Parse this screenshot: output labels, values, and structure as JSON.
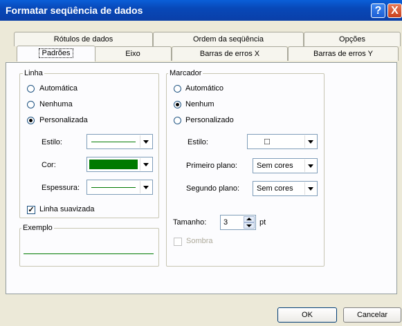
{
  "window": {
    "title": "Formatar seqüência de dados",
    "help_icon": "?",
    "close_icon": "X"
  },
  "tabs_back": [
    {
      "label": "Rótulos de dados"
    },
    {
      "label": "Ordem da seqüência"
    },
    {
      "label": "Opções"
    }
  ],
  "tabs_front": [
    {
      "label": "Padrões",
      "active": true
    },
    {
      "label": "Eixo"
    },
    {
      "label": "Barras de erros X"
    },
    {
      "label": "Barras de erros Y"
    }
  ],
  "linha": {
    "group_label": "Linha",
    "options": [
      {
        "label": "Automática",
        "selected": false
      },
      {
        "label": "Nenhuma",
        "selected": false
      },
      {
        "label": "Personalizada",
        "selected": true
      }
    ],
    "estilo_label": "Estilo:",
    "cor_label": "Cor:",
    "espessura_label": "Espessura:",
    "line_color": "#007a00",
    "smooth_label": "Linha suavizada",
    "smooth_checked": true,
    "check_mark": "✓"
  },
  "exemplo": {
    "group_label": "Exemplo"
  },
  "marcador": {
    "group_label": "Marcador",
    "options": [
      {
        "label": "Automático",
        "selected": false
      },
      {
        "label": "Nenhum",
        "selected": true
      },
      {
        "label": "Personalizado",
        "selected": false
      }
    ],
    "estilo_label": "Estilo:",
    "estilo_value": "□",
    "primeiro_label": "Primeiro plano:",
    "primeiro_value": "Sem cores",
    "segundo_label": "Segundo plano:",
    "segundo_value": "Sem cores",
    "tamanho_label": "Tamanho:",
    "tamanho_value": "3",
    "tamanho_unit": "pt",
    "sombra_label": "Sombra"
  },
  "buttons": {
    "ok": "OK",
    "cancel": "Cancelar"
  }
}
